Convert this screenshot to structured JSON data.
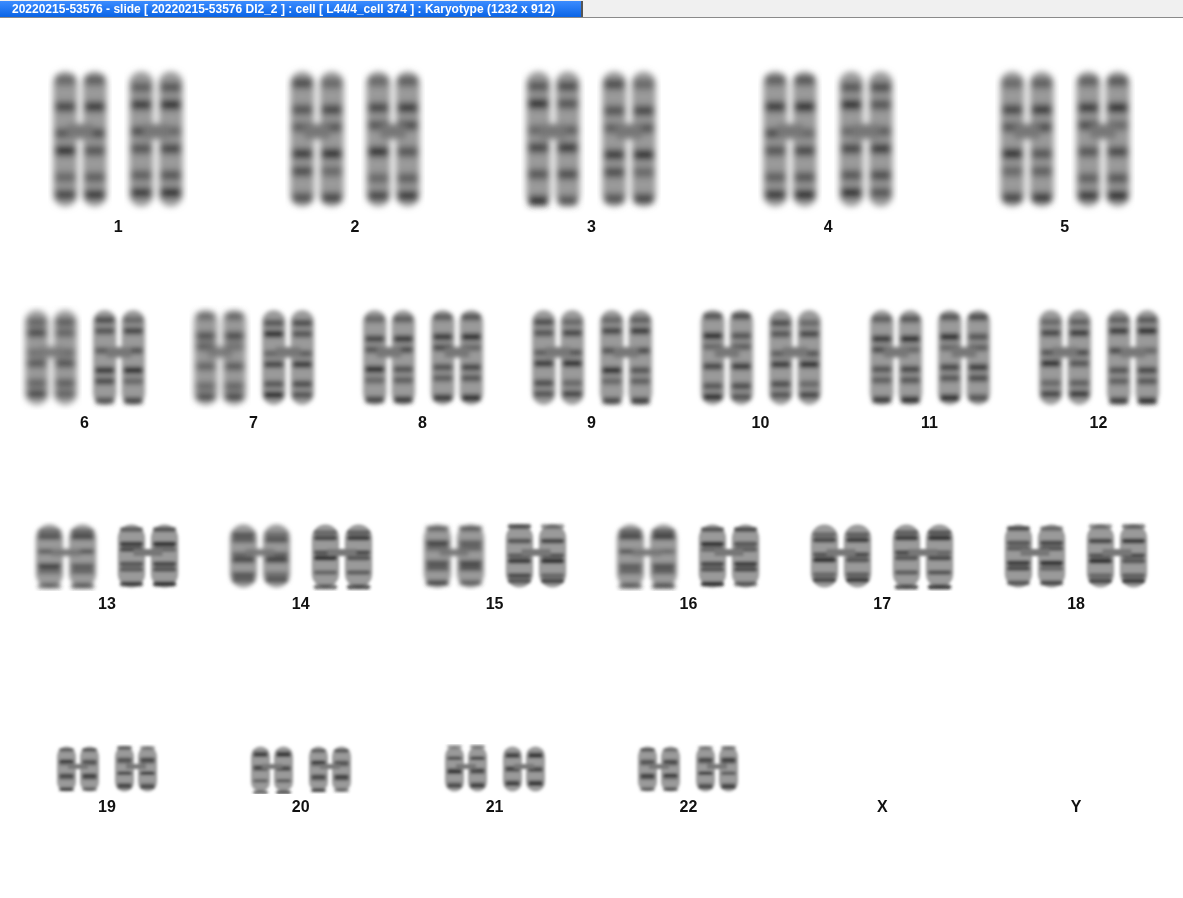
{
  "window": {
    "title": "20220215-53576 - slide [ 20220215-53576 DI2_2 ] : cell [ L44/4_cell 374 ] : Karyotype  (1232 x 912)"
  },
  "rows": [
    {
      "groups": [
        {
          "label": "1",
          "empty": false
        },
        {
          "label": "2",
          "empty": false
        },
        {
          "label": "3",
          "empty": false
        },
        {
          "label": "4",
          "empty": false
        },
        {
          "label": "5",
          "empty": false
        }
      ]
    },
    {
      "groups": [
        {
          "label": "6",
          "empty": false
        },
        {
          "label": "7",
          "empty": false
        },
        {
          "label": "8",
          "empty": false
        },
        {
          "label": "9",
          "empty": false
        },
        {
          "label": "10",
          "empty": false
        },
        {
          "label": "11",
          "empty": false
        },
        {
          "label": "12",
          "empty": false
        }
      ]
    },
    {
      "groups": [
        {
          "label": "13",
          "empty": false
        },
        {
          "label": "14",
          "empty": false
        },
        {
          "label": "15",
          "empty": false
        },
        {
          "label": "16",
          "empty": false
        },
        {
          "label": "17",
          "empty": false
        },
        {
          "label": "18",
          "empty": false
        }
      ]
    },
    {
      "groups": [
        {
          "label": "19",
          "empty": false
        },
        {
          "label": "20",
          "empty": false
        },
        {
          "label": "21",
          "empty": false
        },
        {
          "label": "22",
          "empty": false
        },
        {
          "label": "X",
          "empty": true
        },
        {
          "label": "Y",
          "empty": true
        }
      ]
    }
  ]
}
